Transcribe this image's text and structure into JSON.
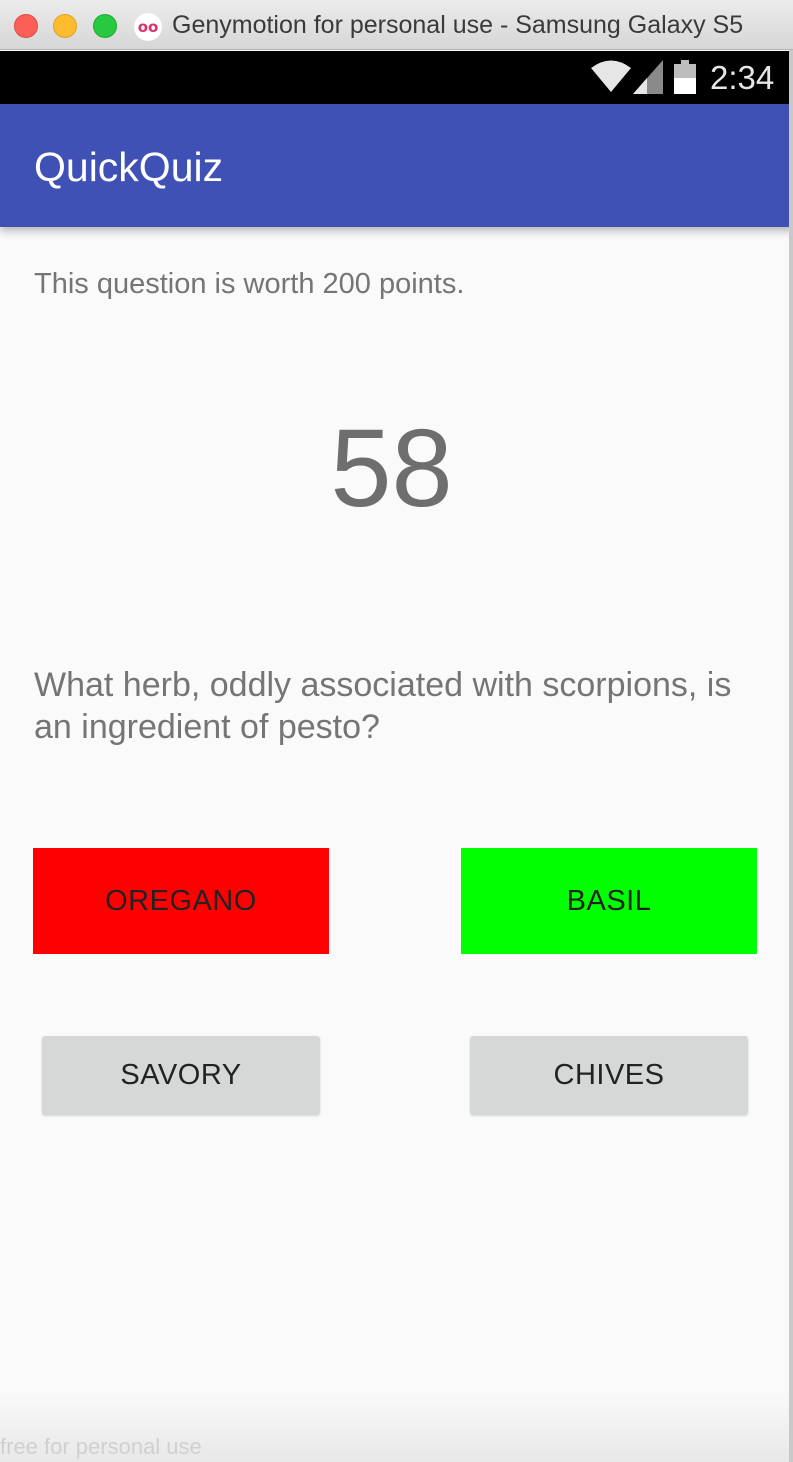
{
  "window": {
    "title": "Genymotion for personal use - Samsung Galaxy S5",
    "logo_glyph": "oo",
    "watermark": "free for personal use"
  },
  "statusbar": {
    "time": "2:34",
    "icons": [
      "wifi-icon",
      "signal-icon",
      "battery-icon"
    ]
  },
  "appbar": {
    "title": "QuickQuiz",
    "color": "#3f51b5"
  },
  "quiz": {
    "points_text": "This question is worth 200 points.",
    "timer": "58",
    "question": "What herb, oddly associated with scorpions, is an ingredient of pesto?",
    "answers": [
      {
        "label": "OREGANO",
        "color": "#ff0000"
      },
      {
        "label": "BASIL",
        "color": "#00ff00"
      },
      {
        "label": "SAVORY",
        "color": "#d6d7d7"
      },
      {
        "label": "CHIVES",
        "color": "#d6d7d7"
      }
    ]
  }
}
